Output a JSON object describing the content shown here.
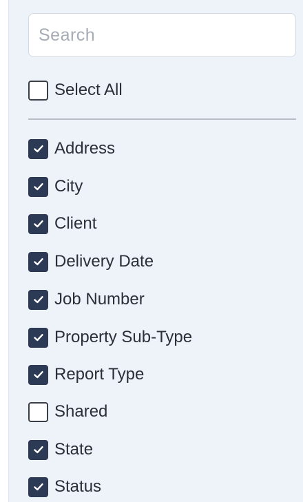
{
  "search": {
    "placeholder": "Search",
    "value": ""
  },
  "select_all": {
    "label": "Select All",
    "checked": false
  },
  "columns": [
    {
      "label": "Address",
      "checked": true
    },
    {
      "label": "City",
      "checked": true
    },
    {
      "label": "Client",
      "checked": true
    },
    {
      "label": "Delivery Date",
      "checked": true
    },
    {
      "label": "Job Number",
      "checked": true
    },
    {
      "label": "Property Sub-Type",
      "checked": true
    },
    {
      "label": "Report Type",
      "checked": true
    },
    {
      "label": "Shared",
      "checked": false
    },
    {
      "label": "State",
      "checked": true
    },
    {
      "label": "Status",
      "checked": true
    }
  ],
  "icons": {
    "check": "check-icon"
  },
  "colors": {
    "checked_fill": "#2d3a55",
    "panel_background": "#eef2f9"
  }
}
